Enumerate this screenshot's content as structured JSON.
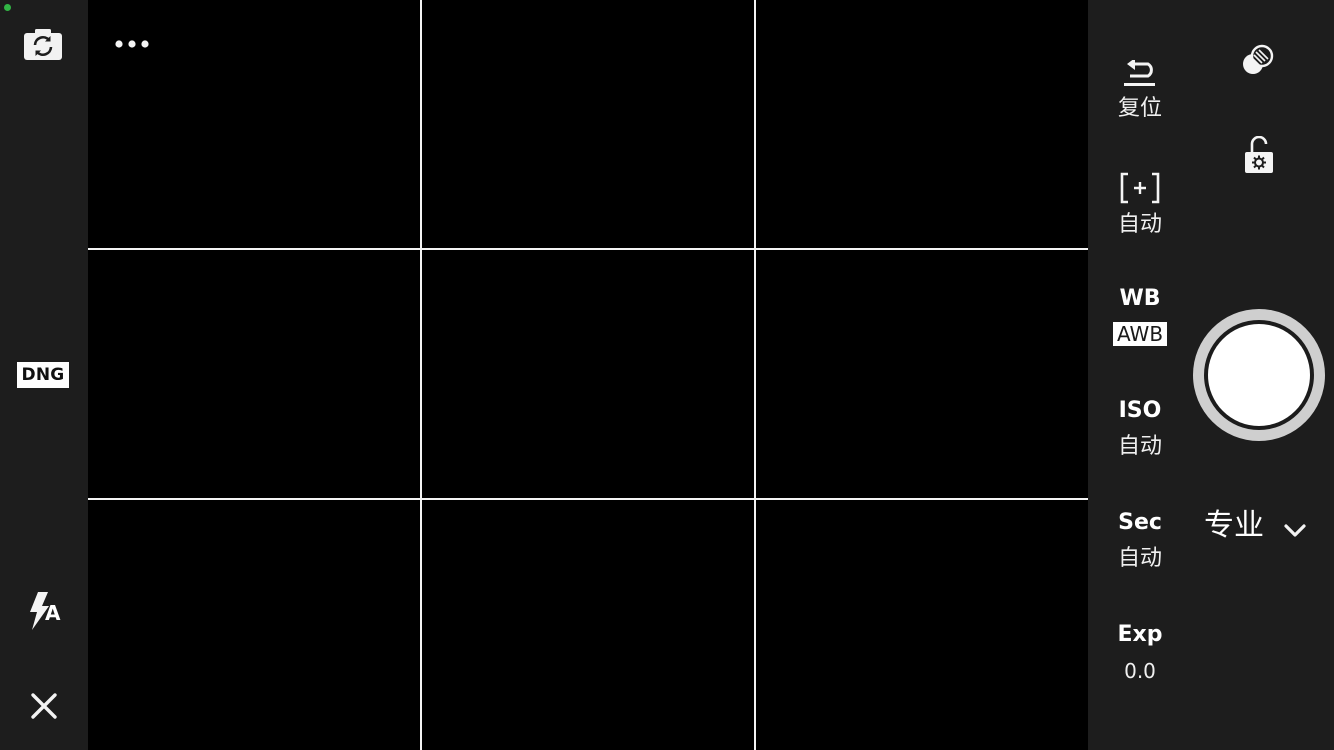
{
  "left_toolbar": {
    "switch_camera_icon": "camera-switch-icon",
    "raw_format_label": "DNG",
    "flash_icon": "flash-auto-icon",
    "flash_mode_label": "A",
    "close_icon": "close-icon"
  },
  "viewfinder": {
    "more_icon": "more-options-icon",
    "grid": "3x3"
  },
  "controls": {
    "reset": {
      "icon": "undo-icon",
      "value": "复位"
    },
    "focus": {
      "icon": "focus-bracket-icon",
      "value": "自动"
    },
    "white_balance": {
      "label": "WB",
      "value": "AWB"
    },
    "iso": {
      "label": "ISO",
      "value": "自动"
    },
    "shutter_speed": {
      "label": "Sec",
      "value": "自动"
    },
    "exposure": {
      "label": "Exp",
      "value": "0.0"
    }
  },
  "right_panel": {
    "filter_icon": "filter-effects-icon",
    "lock_icon": "settings-lock-icon",
    "mode_label": "专业",
    "mode_chevron": "chevron-down-icon"
  },
  "colors": {
    "panel_background": "#1d1d1d",
    "viewfinder_background": "#000000",
    "grid_lines": "#f4f4f4",
    "status_dot": "#31b545"
  }
}
